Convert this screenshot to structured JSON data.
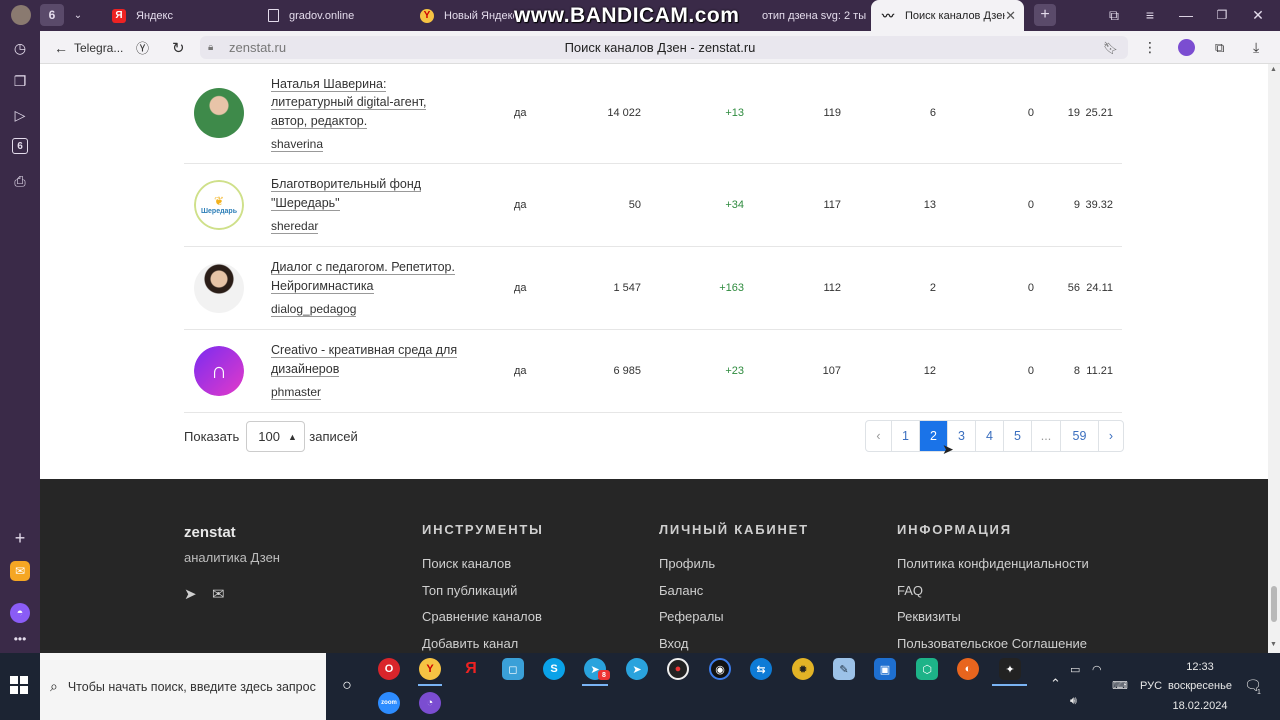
{
  "browser": {
    "tabs": [
      {
        "title": "",
        "icon": "avatar-icon"
      },
      {
        "title": "Яндекс",
        "icon": "yandex-icon"
      },
      {
        "title": "gradov.online",
        "icon": "page-icon"
      },
      {
        "title": "Новый Яндекс Б",
        "icon": "yandex-browser-icon"
      },
      {
        "title": "отип дзена svg: 2 ты",
        "icon": "yandex-icon"
      },
      {
        "title": "Поиск каналов Дзен",
        "icon": "chart-icon",
        "active": true
      }
    ],
    "tab_count_badge": "6",
    "watermark": "www.BANDICAM.com",
    "back_label": "Telegra...",
    "address_host": "zenstat.ru",
    "page_title": "Поиск каналов Дзен - zenstat.ru",
    "sidebar_badge": "6"
  },
  "channels": [
    {
      "name": "Наталья Шаверина: литературный digital-агент, автор, редактор.",
      "slug": "shaverina",
      "verified": "да",
      "subscribers": "14 022",
      "growth": "+13",
      "c1": "119",
      "c2": "6",
      "c3": "0",
      "c4": "19",
      "c5": "25.21",
      "avatar": "person-avatar-green"
    },
    {
      "name": "Благотворительный фонд \"Шередарь\"",
      "slug": "sheredar",
      "verified": "да",
      "subscribers": "50",
      "growth": "+34",
      "c1": "117",
      "c2": "13",
      "c3": "0",
      "c4": "9",
      "c5": "39.32",
      "avatar": "sheredar-logo",
      "avatar_text": "Шередарь"
    },
    {
      "name": "Диалог с педагогом. Репетитор. Нейрогимнастика",
      "slug": "dialog_pedagog",
      "verified": "да",
      "subscribers": "1 547",
      "growth": "+163",
      "c1": "112",
      "c2": "2",
      "c3": "0",
      "c4": "56",
      "c5": "24.11",
      "avatar": "person-avatar-light"
    },
    {
      "name": "Creativo - креативная среда для дизайнеров",
      "slug": "phmaster",
      "verified": "да",
      "subscribers": "6 985",
      "growth": "+23",
      "c1": "107",
      "c2": "12",
      "c3": "0",
      "c4": "8",
      "c5": "11.21",
      "avatar": "creativo-logo"
    }
  ],
  "page_size": {
    "label_before": "Показать",
    "value": "100",
    "label_after": "записей"
  },
  "pagination": {
    "prev": "‹",
    "pages": [
      "1",
      "2",
      "3",
      "4",
      "5",
      "...",
      "59"
    ],
    "active": "2",
    "next": "›"
  },
  "footer": {
    "brand": "zenstat",
    "tagline": "аналитика Дзен",
    "columns": [
      {
        "title": "ИНСТРУМЕНТЫ",
        "links": [
          "Поиск каналов",
          "Топ публикаций",
          "Сравнение каналов",
          "Добавить канал"
        ]
      },
      {
        "title": "ЛИЧНЫЙ КАБИНЕТ",
        "links": [
          "Профиль",
          "Баланс",
          "Рефералы",
          "Вход"
        ]
      },
      {
        "title": "ИНФОРМАЦИЯ",
        "links": [
          "Политика конфиденциальности",
          "FAQ",
          "Реквизиты",
          "Пользовательское Соглашение"
        ]
      }
    ]
  },
  "taskbar": {
    "search_placeholder": "Чтобы начать поиск, введите здесь запрос",
    "zoom_label": "zoom",
    "language": "РУС",
    "time": "12:33",
    "day": "воскресенье",
    "date": "18.02.2024",
    "telegram_badge": "8",
    "notification_count": "1"
  },
  "colors": {
    "accent": "#1a73e8",
    "growth": "#2e8b3e",
    "footer_bg": "#262626",
    "taskbar_bg": "#1c2433"
  }
}
